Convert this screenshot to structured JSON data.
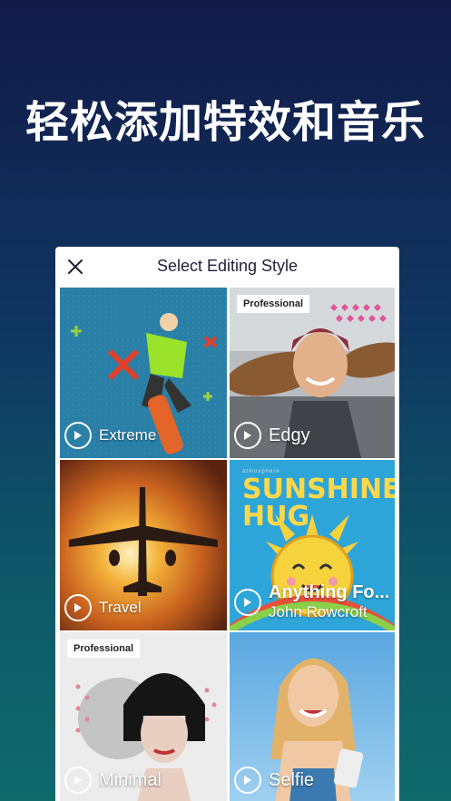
{
  "headline": "轻松添加特效和音乐",
  "dialog": {
    "title": "Select Editing Style",
    "close_icon": "close-icon"
  },
  "styles": [
    {
      "label": "Extreme",
      "badge": ""
    },
    {
      "label": "Edgy",
      "badge": "Professional"
    },
    {
      "label": "Travel",
      "badge": ""
    },
    {
      "label": "Anything Fo...",
      "sublabel": "John Rowcroft",
      "art_title": "SUNSHINE HUG",
      "art_small": "atmosphere",
      "badge": ""
    },
    {
      "label": "Minimal",
      "badge": "Professional"
    },
    {
      "label": "Selfie",
      "badge": ""
    }
  ],
  "colors": {
    "bg_top": "#121a48",
    "bg_bottom": "#0f6a6c",
    "panel": "#ffffff"
  }
}
